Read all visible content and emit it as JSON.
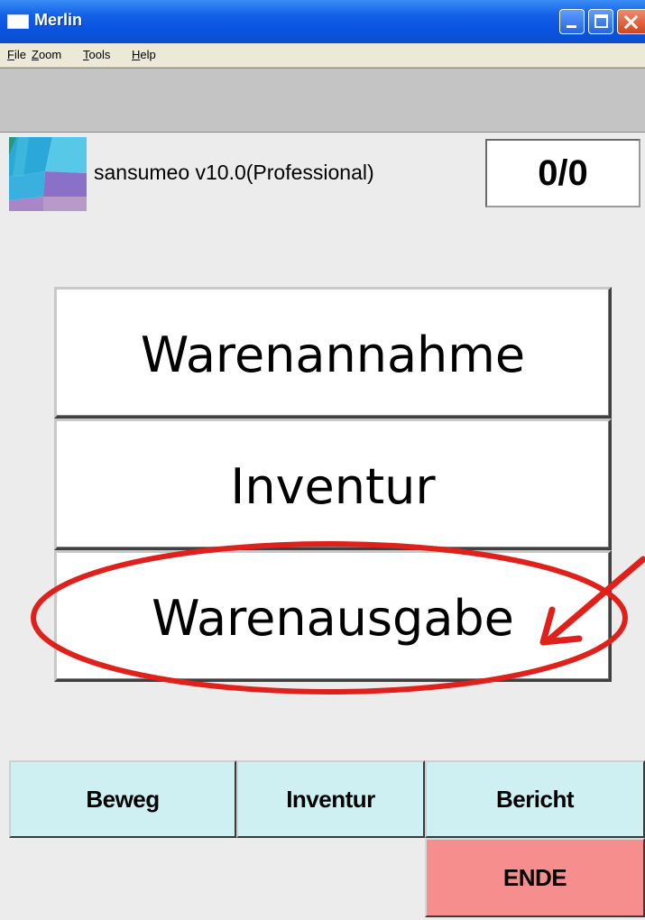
{
  "window": {
    "title": "Merlin",
    "controls": [
      "minimize-icon",
      "maximize-icon",
      "close-icon"
    ]
  },
  "menu": {
    "items": [
      "File",
      "Zoom",
      "Tools",
      "Help"
    ]
  },
  "header": {
    "app_version": "sansumeo v10.0(Professional)",
    "counter": "0/0"
  },
  "main": {
    "buttons": [
      {
        "label": "Warenannahme"
      },
      {
        "label": "Inventur"
      },
      {
        "label": "Warenausgabe"
      }
    ]
  },
  "annotation": {
    "shape": "ellipse-with-arrow",
    "color": "#e0201a",
    "target": "Warenausgabe"
  },
  "toolbar": {
    "buttons": [
      {
        "label": "Beweg"
      },
      {
        "label": "Inventur"
      },
      {
        "label": "Bericht"
      }
    ],
    "exit_label": "ENDE"
  },
  "colors": {
    "titlebar": "#0a53e0",
    "toolbar_button": "#cff0f3",
    "exit_button": "#f78e8e",
    "annotation": "#e0201a"
  }
}
